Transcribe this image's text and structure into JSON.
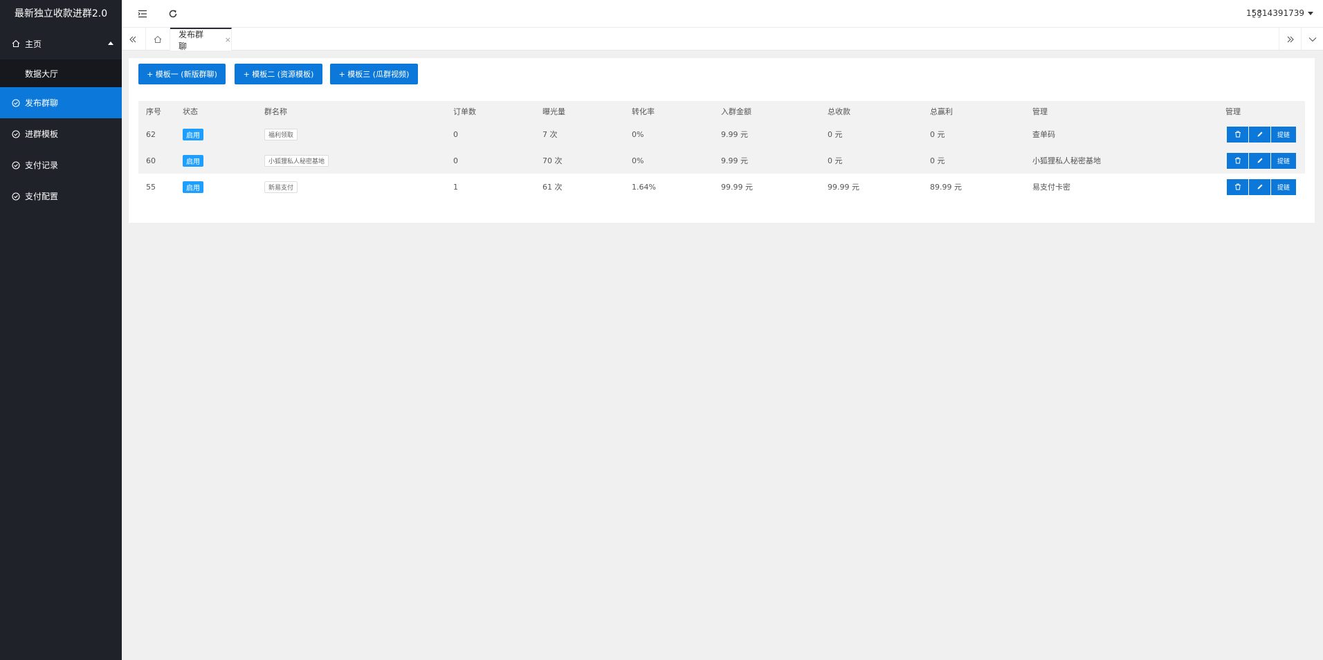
{
  "app": {
    "title": "最新独立收款进群2.0"
  },
  "sidebar": {
    "main_label": "主页",
    "sub_dashboard": "数据大厅",
    "items": [
      {
        "label": "发布群聊",
        "active": true
      },
      {
        "label": "进群模板"
      },
      {
        "label": "支付记录"
      },
      {
        "label": "支付配置"
      }
    ]
  },
  "header": {
    "user": "15814391739"
  },
  "tabs": {
    "active_label": "发布群聊",
    "close_glyph": "×"
  },
  "toolbar": {
    "buttons": [
      "+ 模板一 (新版群聊)",
      "+ 模板二 (资源模板)",
      "+ 模板三 (瓜群视频)"
    ]
  },
  "table": {
    "headers": [
      "序号",
      "状态",
      "群名称",
      "订单数",
      "曝光量",
      "转化率",
      "入群金额",
      "总收款",
      "总赢利",
      "管理",
      "管理"
    ],
    "rows": [
      {
        "id": "62",
        "status": "启用",
        "name": "福利领取",
        "orders": "0",
        "views": "7 次",
        "rate": "0%",
        "fee": "9.99 元",
        "income": "0 元",
        "profit": "0 元",
        "manage": "查单码",
        "withdraw": "提链"
      },
      {
        "id": "60",
        "status": "启用",
        "name": "小狐狸私人秘密基地",
        "orders": "0",
        "views": "70 次",
        "rate": "0%",
        "fee": "9.99 元",
        "income": "0 元",
        "profit": "0 元",
        "manage": "小狐狸私人秘密基地",
        "withdraw": "提链"
      },
      {
        "id": "55",
        "status": "启用",
        "name": "新易支付",
        "orders": "1",
        "views": "61 次",
        "rate": "1.64%",
        "fee": "99.99 元",
        "income": "99.99 元",
        "profit": "89.99 元",
        "manage": "易支付卡密",
        "withdraw": "提链"
      }
    ]
  },
  "colors": {
    "sidebar_bg": "#20222a",
    "accent": "#0c78d9",
    "badge": "#1e9fff"
  }
}
